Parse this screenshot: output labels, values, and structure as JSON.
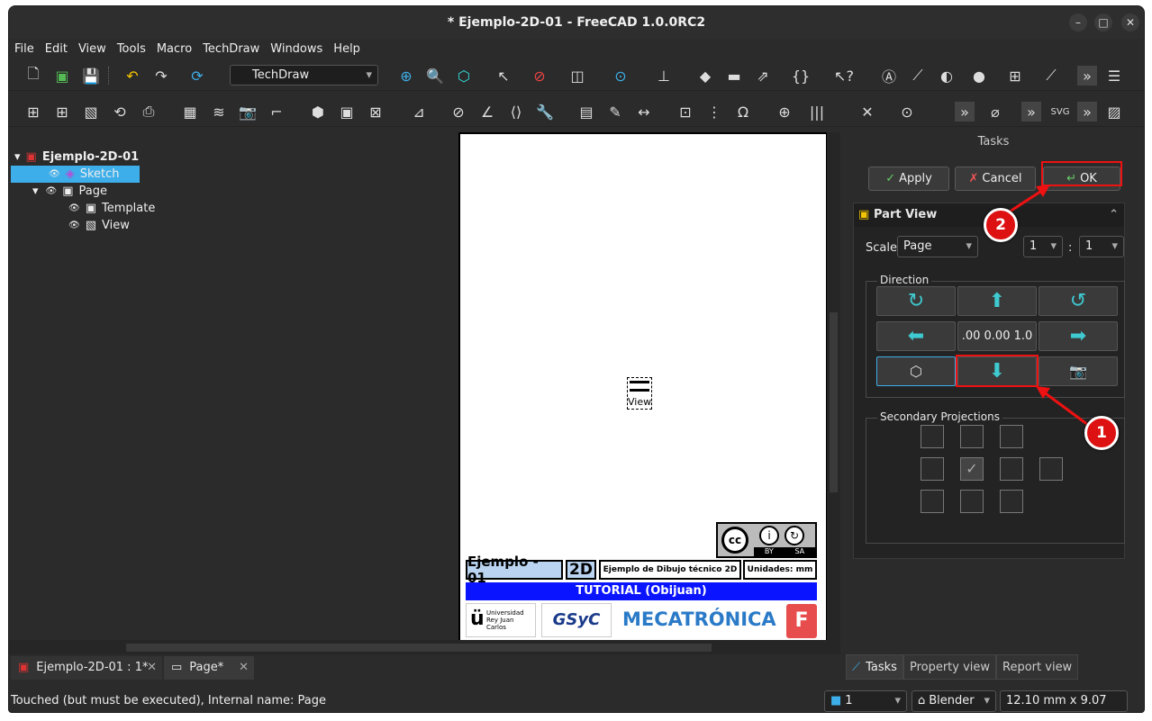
{
  "window": {
    "title": "* Ejemplo-2D-01 - FreeCAD 1.0.0RC2"
  },
  "menu": [
    "File",
    "Edit",
    "View",
    "Tools",
    "Macro",
    "TechDraw",
    "Windows",
    "Help"
  ],
  "toolbar": {
    "workbench": "TechDraw"
  },
  "tree": {
    "root": "Ejemplo-2D-01",
    "items": [
      "Sketch",
      "Page",
      "Template",
      "View"
    ]
  },
  "drawing": {
    "view_label": "View",
    "license_by": "BY",
    "license_sa": "SA",
    "title_name": "Ejemplo - 01",
    "title_type": "2D",
    "title_desc": "Ejemplo de Dibujo técnico 2D",
    "title_units": "Unidades: mm",
    "tutorial": "TUTORIAL (Obijuan)",
    "uni_line1": "Universidad",
    "uni_line2": "Rey Juan Carlos",
    "gsyc": "GSyC",
    "mecatronica": "MECATRÓNICA"
  },
  "tasks": {
    "header": "Tasks",
    "apply": "Apply",
    "cancel": "Cancel",
    "ok": "OK",
    "panel_title": "Part View",
    "scale_label": "Scale",
    "scale_value": "Page",
    "scale_num": "1",
    "scale_sep": ":",
    "scale_den": "1",
    "direction_label": "Direction",
    "direction_value": ".00 0.00 1.0",
    "secondary_label": "Secondary Projections"
  },
  "annotations": {
    "one": "1",
    "two": "2"
  },
  "tabs": {
    "doc1": "Ejemplo-2D-01 : 1*",
    "doc2": "Page*"
  },
  "right_tabs": [
    "Tasks",
    "Property view",
    "Report view"
  ],
  "status": {
    "message": "Touched (but must be executed), Internal name: Page",
    "layer": "1",
    "nav": "Blender",
    "dims": "12.10 mm x 9.07 mm"
  },
  "colors": {
    "accent": "#3daee9",
    "annotation": "#e11111",
    "tutorial_bar": "#0a14ff"
  }
}
